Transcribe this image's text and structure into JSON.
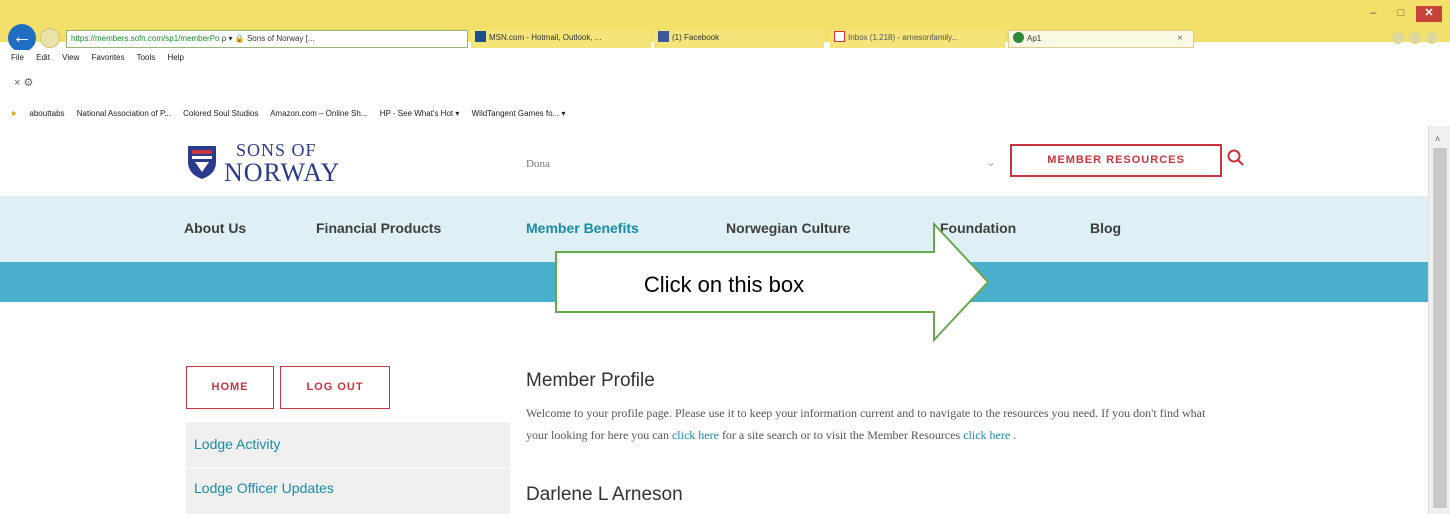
{
  "browser": {
    "address_url": "https://members.sofn.com/sp1/memberPo",
    "address_controls": "ρ ▾",
    "address_site": "Sons of Norway [...",
    "tabs": [
      {
        "label": "MSN.com - Hotmail, Outlook, ..."
      },
      {
        "label": "(1) Facebook"
      },
      {
        "label": "Inbox (1,218) - arnesonfamily..."
      },
      {
        "label": "Ap1",
        "close": "×"
      }
    ],
    "menu": [
      "File",
      "Edit",
      "View",
      "Favorites",
      "Tools",
      "Help"
    ],
    "command_bar": "× ⚙",
    "favorites": [
      "abouttabs",
      "National Association of P...",
      "Colored Soul Studios",
      "Amazon.com – Online Sh...",
      "HP - See What's Hot ▾",
      "WildTangent Games fo... ▾"
    ],
    "window_controls": [
      "–",
      "□",
      "✕"
    ],
    "scroll_up": "˄",
    "back_icon": "←"
  },
  "site": {
    "logo_line1": "SONS OF",
    "logo_line2": "NORWAY",
    "donate": "Dona",
    "chevron": "⌄",
    "member_resources": "MEMBER RESOURCES",
    "nav": [
      "About Us",
      "Financial Products",
      "Member Benefits",
      "Norwegian Culture",
      "Foundation",
      "Blog"
    ],
    "active_nav_color": "#1a8aa8",
    "accent_red": "#c9343f",
    "band_color": "#4bb0cc"
  },
  "sidebar": {
    "home": "HOME",
    "logout": "LOG OUT",
    "items": [
      "Lodge Activity",
      "Lodge Officer Updates"
    ]
  },
  "profile": {
    "title": "Member Profile",
    "text_1": "Welcome to your profile page. Please use it to keep your information current and to navigate to the resources you need. If you don't find what your looking for here you can",
    "link_1": "click here",
    "text_2": "for a site search or to visit the Member Resources",
    "link_2": "click here",
    "text_3": ".",
    "member_name": "Darlene L Arneson"
  },
  "annotation": {
    "callout": "Click on this box"
  }
}
